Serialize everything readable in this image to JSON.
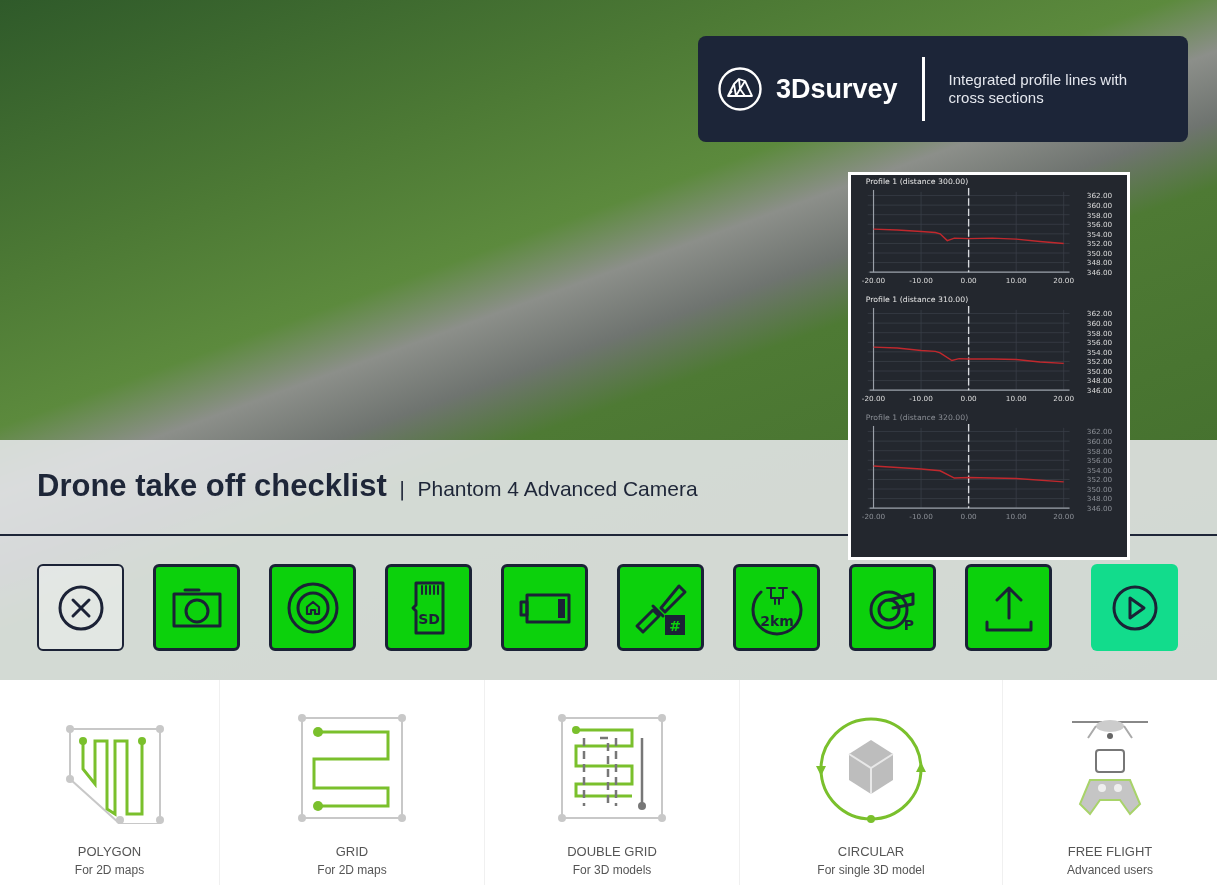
{
  "brand": {
    "name": "3Dsurvey",
    "tagline": "Integrated profile lines with cross sections"
  },
  "profiles": [
    {
      "chart_data": {
        "type": "line",
        "title": "Profile 1 (distance 300.00)",
        "x": [
          -20,
          -15,
          -10,
          -7,
          -6,
          -4.5,
          -3,
          0,
          5,
          10,
          15,
          20
        ],
        "grid": true,
        "ref_lines": [
          {
            "axis": "x",
            "value": 0
          }
        ],
        "series": [
          {
            "color": "#c0282d",
            "values": [
              355,
              354.8,
              354.5,
              354.3,
              354,
              352.6,
              353.1,
              353,
              353.1,
              352.9,
              352.4,
              352
            ]
          }
        ],
        "xlim": [
          -20,
          20
        ],
        "ylim": [
          346,
          362
        ],
        "xticks": [
          {
            "value": -20,
            "label": "-20.00"
          },
          {
            "value": -10,
            "label": "-10.00"
          },
          {
            "value": 0,
            "label": "0.00"
          },
          {
            "value": 10,
            "label": "10.00"
          },
          {
            "value": 20,
            "label": "20.00"
          }
        ],
        "yticks": [
          {
            "value": 346,
            "label": "346.00"
          },
          {
            "value": 348,
            "label": "348.00"
          },
          {
            "value": 350,
            "label": "350.00"
          },
          {
            "value": 352,
            "label": "352.00"
          },
          {
            "value": 354,
            "label": "354.00"
          },
          {
            "value": 356,
            "label": "356.00"
          },
          {
            "value": 358,
            "label": "358.00"
          },
          {
            "value": 360,
            "label": "360.00"
          },
          {
            "value": 362,
            "label": "362.00"
          }
        ]
      }
    },
    {
      "chart_data": {
        "type": "line",
        "title": "Profile 1 (distance 310.00)",
        "x": [
          -20,
          -15,
          -10,
          -7,
          -6,
          -3.5,
          -2,
          0,
          5,
          10,
          15,
          20
        ],
        "grid": true,
        "ref_lines": [
          {
            "axis": "x",
            "value": 0
          }
        ],
        "series": [
          {
            "color": "#c0282d",
            "values": [
              355,
              354.8,
              354.3,
              354.1,
              353.8,
              352.2,
              352.6,
              352.5,
              352.5,
              352.4,
              351.9,
              351.6
            ]
          }
        ],
        "xlim": [
          -20,
          20
        ],
        "ylim": [
          346,
          362
        ],
        "xticks": [
          {
            "value": -20,
            "label": "-20.00"
          },
          {
            "value": -10,
            "label": "-10.00"
          },
          {
            "value": 0,
            "label": "0.00"
          },
          {
            "value": 10,
            "label": "10.00"
          },
          {
            "value": 20,
            "label": "20.00"
          }
        ],
        "yticks": [
          {
            "value": 346,
            "label": "346.00"
          },
          {
            "value": 348,
            "label": "348.00"
          },
          {
            "value": 350,
            "label": "350.00"
          },
          {
            "value": 352,
            "label": "352.00"
          },
          {
            "value": 354,
            "label": "354.00"
          },
          {
            "value": 356,
            "label": "356.00"
          },
          {
            "value": 358,
            "label": "358.00"
          },
          {
            "value": 360,
            "label": "360.00"
          },
          {
            "value": 362,
            "label": "362.00"
          }
        ]
      }
    },
    {
      "chart_data": {
        "type": "line",
        "title": "Profile 1 (distance 320.00)",
        "x": [
          -20,
          -10,
          -6,
          -3,
          0,
          10,
          20
        ],
        "grid": true,
        "ref_lines": [
          {
            "axis": "x",
            "value": 0
          }
        ],
        "series": [
          {
            "color": "#c0282d",
            "values": [
              354.8,
              354.2,
              353.8,
              352.3,
              352.4,
              352.2,
              351.5
            ]
          }
        ],
        "xlim": [
          -20,
          20
        ],
        "ylim": [
          346,
          362
        ],
        "xticks": [
          {
            "value": -20,
            "label": "-20.00"
          },
          {
            "value": -10,
            "label": "-10.00"
          },
          {
            "value": 0,
            "label": "0.00"
          },
          {
            "value": 10,
            "label": "10.00"
          },
          {
            "value": 20,
            "label": "20.00"
          }
        ],
        "yticks": [
          {
            "value": 346,
            "label": "346.00"
          },
          {
            "value": 348,
            "label": "348.00"
          },
          {
            "value": 350,
            "label": "350.00"
          },
          {
            "value": 352,
            "label": "352.00"
          },
          {
            "value": 354,
            "label": "354.00"
          },
          {
            "value": 356,
            "label": "356.00"
          },
          {
            "value": 358,
            "label": "358.00"
          },
          {
            "value": 360,
            "label": "360.00"
          },
          {
            "value": 362,
            "label": "362.00"
          }
        ]
      }
    }
  ],
  "checklist": {
    "title": "Drone take off checklist",
    "separator": "|",
    "subtitle": "Phantom 4 Advanced Camera",
    "buttons": [
      {
        "kind": "cancel"
      },
      {
        "kind": "camera",
        "passed": true
      },
      {
        "kind": "home",
        "passed": true
      },
      {
        "kind": "sd",
        "passed": true,
        "label": "SD"
      },
      {
        "kind": "battery",
        "passed": true
      },
      {
        "kind": "satellite",
        "passed": true,
        "label": "#"
      },
      {
        "kind": "range",
        "passed": true,
        "label": "2km"
      },
      {
        "kind": "propeller",
        "passed": true,
        "label": "P"
      },
      {
        "kind": "upload",
        "passed": true
      },
      {
        "kind": "start"
      }
    ]
  },
  "flight_modes": [
    {
      "kind": "polygon",
      "title": "POLYGON",
      "subtitle": "For 2D maps"
    },
    {
      "kind": "grid",
      "title": "GRID",
      "subtitle": "For 2D maps"
    },
    {
      "kind": "double-grid",
      "title": "DOUBLE GRID",
      "subtitle": "For 3D models"
    },
    {
      "kind": "circular",
      "title": "CIRCULAR",
      "subtitle": "For single 3D model"
    },
    {
      "kind": "free",
      "title": "FREE FLIGHT",
      "subtitle": "Advanced users"
    }
  ]
}
